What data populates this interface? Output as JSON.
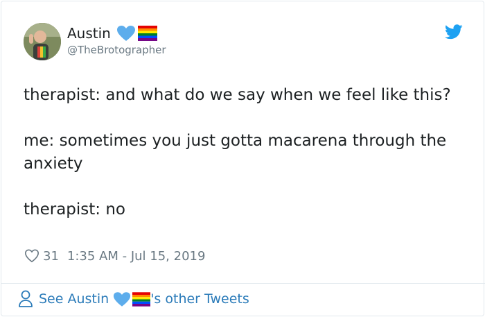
{
  "author": {
    "display_name": "Austin",
    "handle": "@TheBrotographer"
  },
  "tweet": {
    "paragraphs": [
      "therapist: and what do we say when we feel like this?",
      "me: sometimes you just gotta macarena through the anxiety",
      "therapist: no"
    ]
  },
  "meta": {
    "like_count": "31",
    "timestamp": "1:35 AM - Jul 15, 2019"
  },
  "footer": {
    "prefix": "See Austin",
    "suffix": "'s other Tweets"
  },
  "colors": {
    "link": "#2b7bb9",
    "twitter_blue": "#1da1f2",
    "heart_emoji": "#5dadec",
    "muted": "#697882"
  },
  "icons": {
    "brand": "twitter-bird-icon",
    "like": "heart-outline-icon",
    "profile": "user-outline-icon",
    "name_emoji_1": "blue-heart-emoji",
    "name_emoji_2": "rainbow-flag-emoji"
  }
}
